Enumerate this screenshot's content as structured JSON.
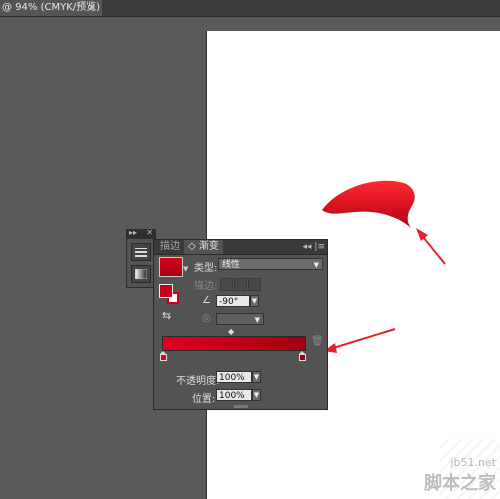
{
  "document": {
    "tab_title": "@ 94% (CMYK/预览)",
    "close_glyph": "×"
  },
  "toolstrip": {
    "collapse_glyph": "▸▸",
    "close_glyph": "✕"
  },
  "gradient_panel": {
    "tabs": [
      {
        "label": "描边"
      },
      {
        "label": "◇ 渐变"
      }
    ],
    "panel_controls": "◂◂ |≡",
    "type_label": "类型:",
    "type_value": "线性",
    "stroke_label": "描边:",
    "angle_value": "-90°",
    "opacity_label": "不透明度:",
    "opacity_value": "100%",
    "position_label": "位置:",
    "position_value": "100%",
    "gradient_start_color": "#e0001e",
    "gradient_end_color": "#a0000e"
  },
  "watermark": {
    "line1": "jb51.net",
    "line2": "脚本之家"
  },
  "colors": {
    "shape_red": "#d40016",
    "annotation_red": "#e8202a",
    "canvas_gray": "#5a5a5a"
  }
}
